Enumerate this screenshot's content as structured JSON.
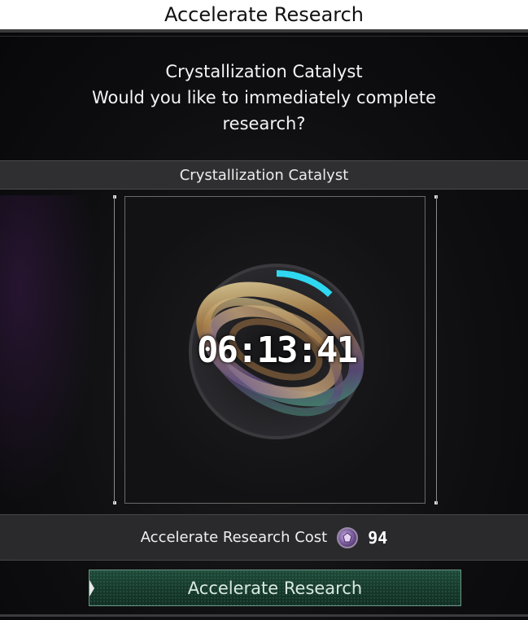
{
  "header": {
    "title": "Accelerate Research"
  },
  "prompt": {
    "item_name": "Crystallization Catalyst",
    "question": "Would you like to immediately complete research?"
  },
  "panel": {
    "header_label": "Crystallization Catalyst"
  },
  "item": {
    "icon": "crystallization-catalyst-icon",
    "timer": "06:13:41",
    "progress_fraction": 0.12
  },
  "cost": {
    "label": "Accelerate Research Cost",
    "currency_icon": "crystal-coin-icon",
    "value": "94"
  },
  "actions": {
    "accelerate_label": "Accelerate Research"
  },
  "colors": {
    "title_bar": "#ffffff",
    "progress_ring": "#2fd8f0",
    "button_green": "#1f4a3a"
  }
}
